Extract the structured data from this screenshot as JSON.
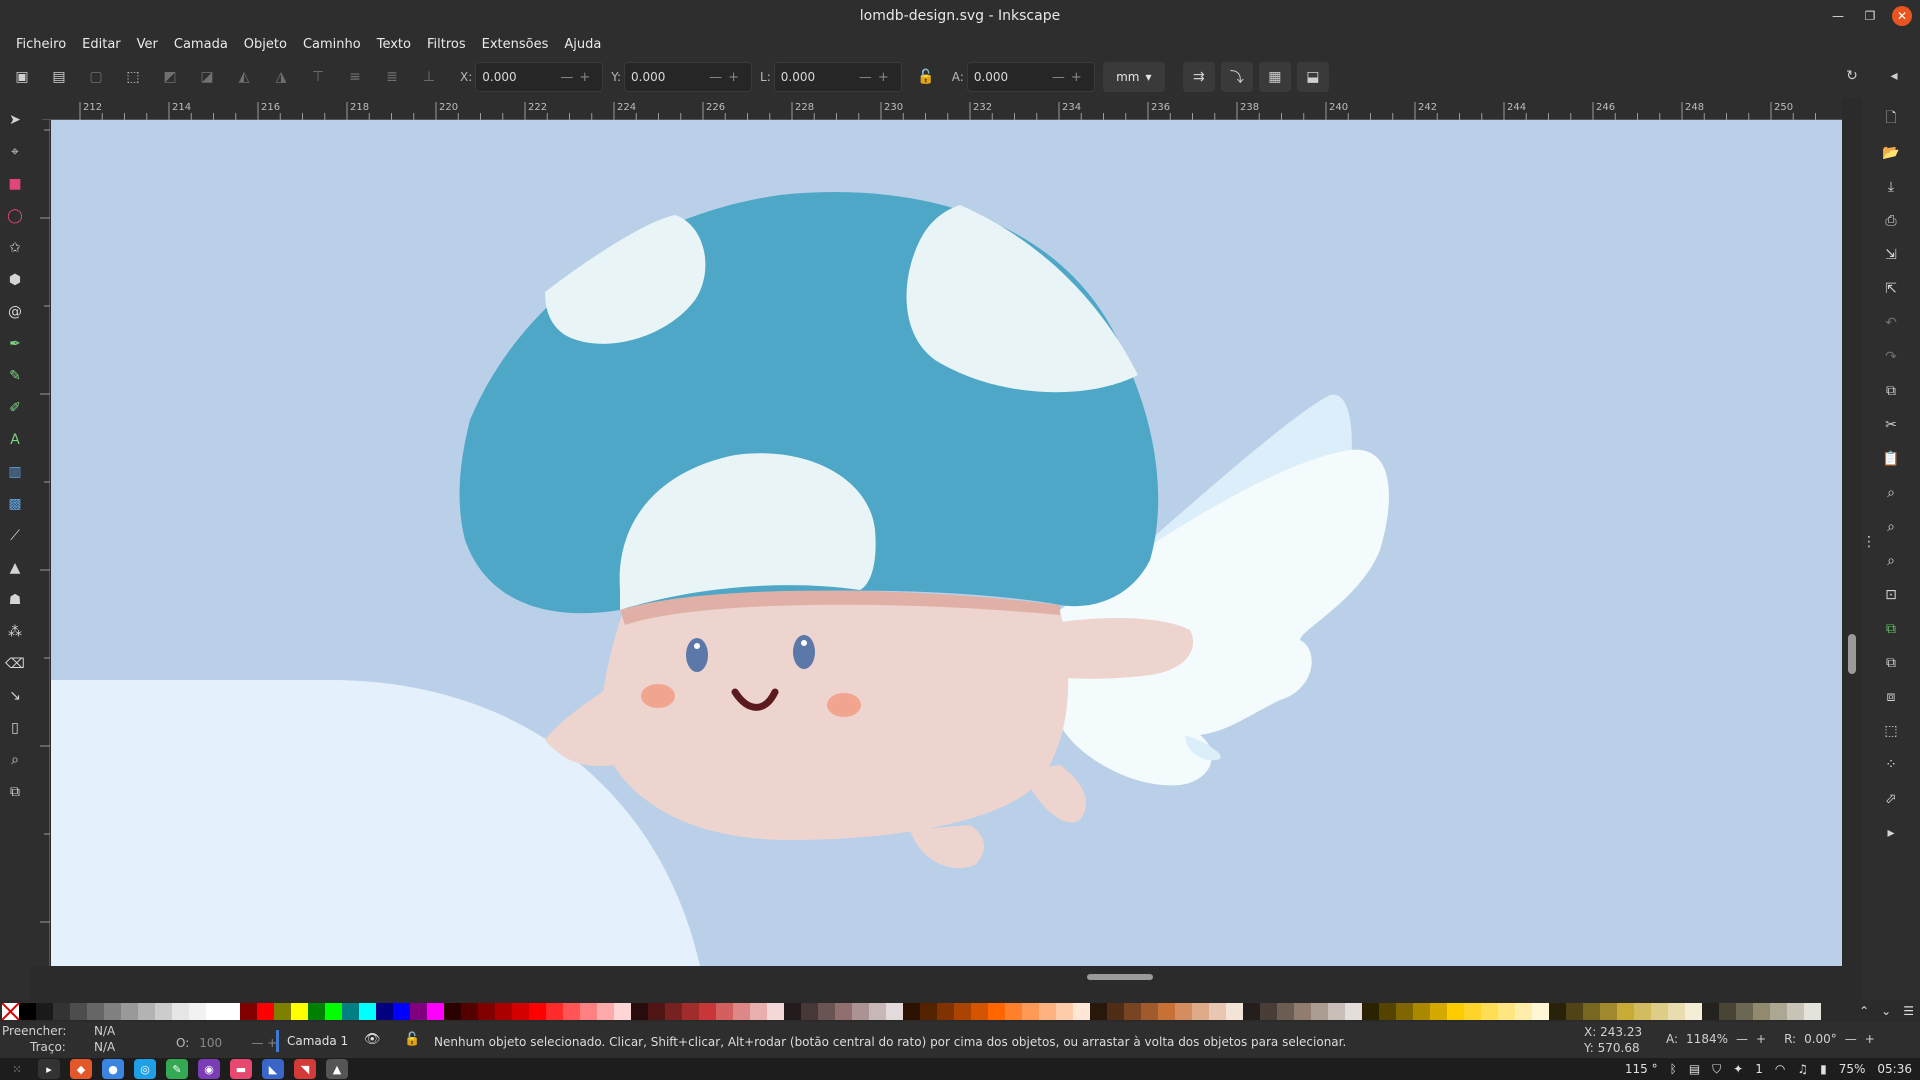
{
  "window": {
    "title": "lomdb-design.svg - Inkscape"
  },
  "menu": [
    "Ficheiro",
    "Editar",
    "Ver",
    "Camada",
    "Objeto",
    "Caminho",
    "Texto",
    "Filtros",
    "Extensões",
    "Ajuda"
  ],
  "toolbar": {
    "x_label": "X:",
    "x_value": "0.000",
    "y_label": "Y:",
    "y_value": "0.000",
    "w_label": "L:",
    "w_value": "0.000",
    "h_label": "A:",
    "h_value": "0.000",
    "unit": "mm"
  },
  "ruler_labels": [
    "212",
    "214",
    "216",
    "218",
    "220",
    "222",
    "224",
    "226",
    "228",
    "230",
    "232",
    "234",
    "236",
    "238",
    "240",
    "242",
    "244",
    "246",
    "248",
    "250"
  ],
  "palette": [
    "#000000",
    "#1a1a1a",
    "#333333",
    "#4d4d4d",
    "#666666",
    "#808080",
    "#999999",
    "#b3b3b3",
    "#cccccc",
    "#e6e6e6",
    "#f2f2f2",
    "#ffffff",
    "#ffffff",
    "#800000",
    "#ff0000",
    "#808000",
    "#ffff00",
    "#008000",
    "#00ff00",
    "#008080",
    "#00ffff",
    "#000080",
    "#0000ff",
    "#800080",
    "#ff00ff",
    "#2b0000",
    "#550000",
    "#800000",
    "#aa0000",
    "#d40000",
    "#ff0000",
    "#ff2a2a",
    "#ff5555",
    "#ff8080",
    "#ffaaaa",
    "#ffd5d5",
    "#280b0b",
    "#501616",
    "#782121",
    "#a02c2c",
    "#c83737",
    "#d35f5f",
    "#de8787",
    "#e9afaf",
    "#f4d7d7",
    "#241c1c",
    "#483737",
    "#6c5353",
    "#916f6f",
    "#ac9393",
    "#c8b7b7",
    "#e3dbdb",
    "#2b1100",
    "#552200",
    "#803300",
    "#aa4400",
    "#d45500",
    "#ff6600",
    "#ff7f2a",
    "#ff9955",
    "#ffb380",
    "#ffccaa",
    "#ffe6d5",
    "#28170b",
    "#502d16",
    "#784421",
    "#a05a2c",
    "#c87137",
    "#d38d5f",
    "#deaa87",
    "#e9c6af",
    "#f4e3d7",
    "#241f1c",
    "#483e37",
    "#6c5d53",
    "#917c6f",
    "#ac9d93",
    "#c8beb7",
    "#e3dedb",
    "#2b2200",
    "#554400",
    "#806600",
    "#aa8800",
    "#d4aa00",
    "#ffcc00",
    "#ffd42a",
    "#ffdd55",
    "#ffe680",
    "#ffeeaa",
    "#fff6d5",
    "#28220b",
    "#504416",
    "#786721",
    "#a0892c",
    "#c8ab37",
    "#d3bc5f",
    "#decd87",
    "#e9ddaf",
    "#f4eed7",
    "#24221c",
    "#484537",
    "#6c6753",
    "#918a6f",
    "#aca793",
    "#c8c4b7",
    "#e3e2db"
  ],
  "status": {
    "fill_label": "Preencher:",
    "fill_value": "N/A",
    "stroke_label": "Traço:",
    "stroke_value": "N/A",
    "opacity_label": "O:",
    "opacity_value": "100",
    "layer": "Camada 1",
    "message": "Nenhum objeto selecionado. Clicar, Shift+clicar, Alt+rodar (botão central do rato) por cima dos objetos, ou arrastar à volta dos objetos para selecionar.",
    "x_label": "X:",
    "x_value": "243.23",
    "y_label": "Y:",
    "y_value": "570.68",
    "zoom_label": "A:",
    "zoom_value": "1184%",
    "rotate_label": "R:",
    "rotate_value": "0.00°"
  },
  "taskbar": {
    "temp": "115 °",
    "workspace": "1",
    "battery": "75%",
    "time": "05:36"
  },
  "icons": {
    "left_tools": [
      "selector-icon",
      "node-icon",
      "rectangle-icon",
      "ellipse-icon",
      "star-icon",
      "box3d-icon",
      "spiral-icon",
      "pen-icon",
      "pencil-icon",
      "calligraphy-icon",
      "text-icon",
      "gradient-icon",
      "mesh-icon",
      "dropper-icon",
      "paint-bucket-icon",
      "tweak-icon",
      "spray-icon",
      "eraser-icon",
      "connector-icon",
      "pages-icon",
      "zoom-icon",
      "clone-icon"
    ],
    "right_tools": [
      "new-doc-icon",
      "open-icon",
      "save-icon",
      "print-icon",
      "import-icon",
      "export-icon",
      "undo-icon",
      "redo-icon",
      "copy-icon",
      "cut-icon",
      "paste-icon",
      "zoom-selection-icon",
      "zoom-drawing-icon",
      "zoom-page-icon",
      "zoom-fit-icon",
      "duplicate-icon",
      "clone-icon",
      "unlink-icon",
      "group-icon",
      "ungroup-icon",
      "fill-stroke-icon",
      "more-icon"
    ]
  }
}
